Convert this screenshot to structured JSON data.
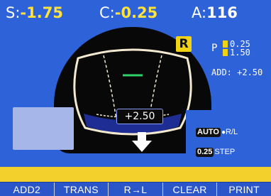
{
  "readout": {
    "sph_label": "S:",
    "sph_value": "-1.75",
    "cyl_label": "C:",
    "cyl_value": "-0.25",
    "axis_label": "A:",
    "axis_value": "116"
  },
  "lens_badge": "R",
  "prism": {
    "p_label": "P",
    "row1_value": "0.25",
    "row2_value": "1.50"
  },
  "add_readout": "ADD: +2.50",
  "add_value": "+2.50",
  "tags": {
    "auto_box": "AUTO",
    "auto_text": "R/L",
    "step_box": "0.25",
    "step_text": "STEP"
  },
  "softkeys": [
    "ADD2",
    "TRANS",
    "R→L",
    "CLEAR",
    "PRINT"
  ],
  "colors": {
    "screen_bg": "#2d62d8",
    "badge": "#f2d313",
    "bar": "#f4d02c",
    "lens_outline": "#f3e9d0",
    "progressive_band": "#1f2f9c",
    "far_zone_line": "#2fd16a"
  },
  "icons": [
    "down-arrow-icon",
    "lens-frame-icon"
  ]
}
